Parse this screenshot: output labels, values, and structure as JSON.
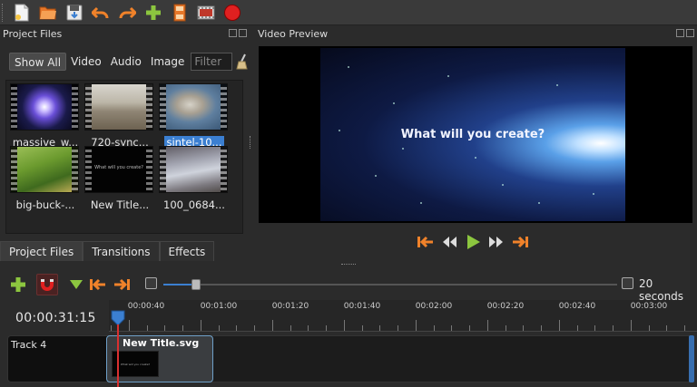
{
  "toolbar": {
    "buttons": [
      "new-project-icon",
      "open-project-icon",
      "save-project-icon",
      "undo-icon",
      "redo-icon",
      "import-files-icon",
      "choose-profile-icon",
      "export-video-icon",
      "record-icon"
    ]
  },
  "project_files": {
    "title": "Project Files",
    "filters": [
      "Show All",
      "Video",
      "Audio",
      "Image"
    ],
    "active_filter": "Show All",
    "filter_placeholder": "Filter",
    "files": [
      {
        "label": "massive_w...",
        "selected": false
      },
      {
        "label": "720-sync...",
        "selected": false
      },
      {
        "label": "sintel-10...",
        "selected": true
      },
      {
        "label": "big-buck-...",
        "selected": false
      },
      {
        "label": "New Title...",
        "selected": false,
        "thumb_text": "What will you create?"
      },
      {
        "label": "100_0684...",
        "selected": false
      }
    ]
  },
  "tabs": [
    "Project Files",
    "Transitions",
    "Effects"
  ],
  "active_tab": "Project Files",
  "video_preview": {
    "title": "Video Preview",
    "overlay_text": "What will you create?"
  },
  "playback": [
    "jump-to-start-icon",
    "rewind-icon",
    "play-icon",
    "fast-forward-icon",
    "jump-to-end-icon"
  ],
  "timeline": {
    "zoom_label": "20 seconds",
    "current_time": "00:00:31:15",
    "ruler_labels": [
      "00:00:40",
      "00:01:00",
      "00:01:20",
      "00:01:40",
      "00:02:00",
      "00:02:20",
      "00:02:40",
      "00:03:00"
    ],
    "track": {
      "name": "Track 4",
      "clip_title": "New Title.svg",
      "clip_thumb_text": "What will you create?"
    }
  },
  "colors": {
    "selection": "#3b7fd1",
    "playhead": "#d93030",
    "play": "#8cc63f",
    "arrows": "#f0822a"
  }
}
